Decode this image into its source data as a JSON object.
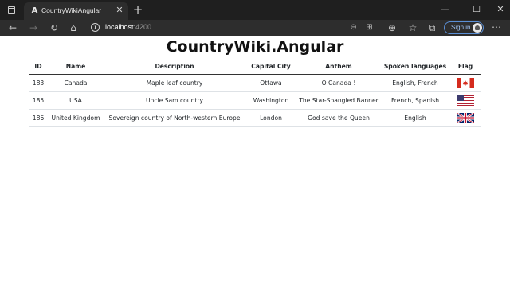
{
  "browser": {
    "tab_title": "CountryWikiAngular",
    "tab_favicon": "A",
    "url_host": "localhost",
    "url_port": ":4200",
    "signin_label": "Sign in"
  },
  "page": {
    "title": "CountryWiki.Angular"
  },
  "table": {
    "headers": [
      "ID",
      "Name",
      "Description",
      "Capital City",
      "Anthem",
      "Spoken languages",
      "Flag"
    ],
    "rows": [
      {
        "id": "183",
        "name": "Canada",
        "description": "Maple leaf country",
        "capital": "Ottawa",
        "anthem": "O Canada !",
        "languages": "English, French",
        "flag": "canada-flag"
      },
      {
        "id": "185",
        "name": "USA",
        "description": "Uncle Sam country",
        "capital": "Washington",
        "anthem": "The Star-Spangled Banner",
        "languages": "French, Spanish",
        "flag": "usa-flag"
      },
      {
        "id": "186",
        "name": "United Kingdom",
        "description": "Sovereign country of North-western Europe",
        "capital": "London",
        "anthem": "God save the Queen",
        "languages": "English",
        "flag": "uk-flag"
      }
    ]
  },
  "colors": {
    "titlebar": "#1f1f1f",
    "toolbar": "#2d2d2d",
    "signin_accent": "#5a8fd6"
  }
}
